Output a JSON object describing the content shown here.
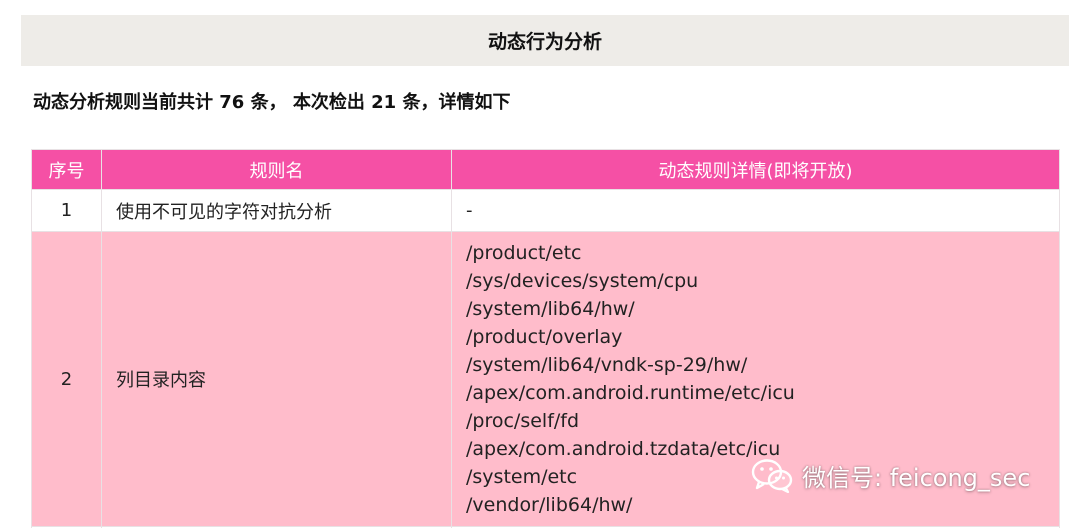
{
  "banner": {
    "title": "动态行为分析"
  },
  "summary": {
    "part1": "动态分析规则当前共计 ",
    "total": "76",
    "part2": " 条， 本次检出 ",
    "detected": "21",
    "part3": " 条，详情如下"
  },
  "table": {
    "headers": [
      "序号",
      "规则名",
      "动态规则详情(即将开放)"
    ],
    "rows": [
      {
        "index": "1",
        "name": "使用不可见的字符对抗分析",
        "detail": "-"
      },
      {
        "index": "2",
        "name": "列目录内容",
        "paths": [
          "/product/etc",
          "/sys/devices/system/cpu",
          "/system/lib64/hw/",
          "/product/overlay",
          "/system/lib64/vndk-sp-29/hw/",
          "/apex/com.android.runtime/etc/icu",
          "/proc/self/fd",
          "/apex/com.android.tzdata/etc/icu",
          "/system/etc",
          "/vendor/lib64/hw/"
        ]
      }
    ]
  },
  "watermark": {
    "text": "微信号: feicong_sec",
    "icon": "wechat-icon"
  },
  "colors": {
    "header_bg": "#f550a5",
    "pink_row_bg": "#ffbccb",
    "banner_bg": "#eeece8"
  }
}
